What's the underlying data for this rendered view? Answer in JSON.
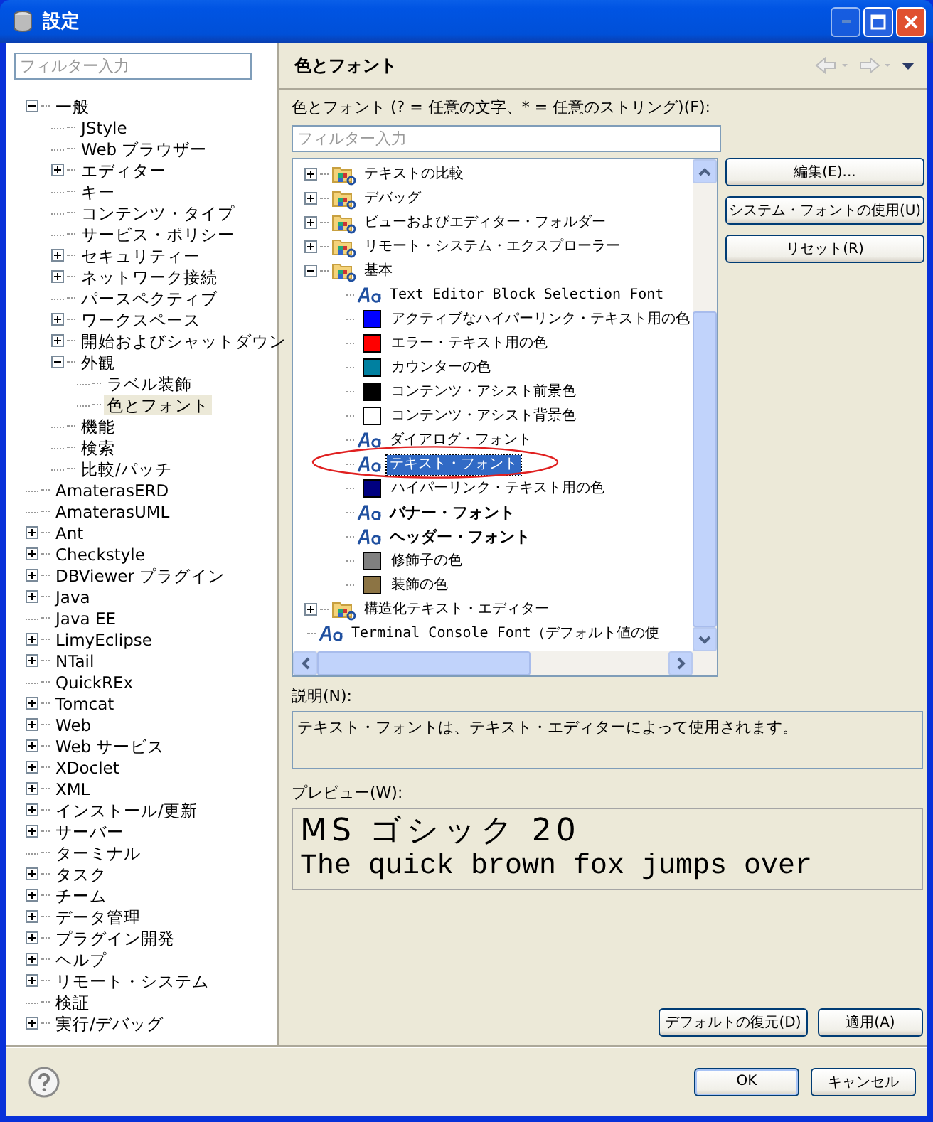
{
  "window": {
    "title": "設定"
  },
  "filter": {
    "placeholder": "フィルター入力"
  },
  "pref_tree": [
    {
      "label": "一般",
      "kind": "group",
      "expanded": true,
      "selected": false,
      "children": [
        {
          "label": "JStyle",
          "kind": "leaf",
          "selected": false
        },
        {
          "label": "Web ブラウザー",
          "kind": "leaf",
          "selected": false
        },
        {
          "label": "エディター",
          "kind": "group",
          "expanded": false,
          "selected": false
        },
        {
          "label": "キー",
          "kind": "leaf",
          "selected": false
        },
        {
          "label": "コンテンツ・タイプ",
          "kind": "leaf",
          "selected": false
        },
        {
          "label": "サービス・ポリシー",
          "kind": "leaf",
          "selected": false
        },
        {
          "label": "セキュリティー",
          "kind": "group",
          "expanded": false,
          "selected": false
        },
        {
          "label": "ネットワーク接続",
          "kind": "group",
          "expanded": false,
          "selected": false
        },
        {
          "label": "パースペクティブ",
          "kind": "leaf",
          "selected": false
        },
        {
          "label": "ワークスペース",
          "kind": "group",
          "expanded": false,
          "selected": false
        },
        {
          "label": "開始およびシャットダウン",
          "kind": "group",
          "expanded": false,
          "selected": false
        },
        {
          "label": "外観",
          "kind": "group",
          "expanded": true,
          "selected": false,
          "children": [
            {
              "label": "ラベル装飾",
              "kind": "leaf",
              "selected": false
            },
            {
              "label": "色とフォント",
              "kind": "leaf",
              "selected": true
            }
          ]
        },
        {
          "label": "機能",
          "kind": "leaf",
          "selected": false
        },
        {
          "label": "検索",
          "kind": "leaf",
          "selected": false
        },
        {
          "label": "比較/パッチ",
          "kind": "leaf",
          "selected": false
        }
      ]
    },
    {
      "label": "AmaterasERD",
      "kind": "leaf",
      "selected": false
    },
    {
      "label": "AmaterasUML",
      "kind": "leaf",
      "selected": false
    },
    {
      "label": "Ant",
      "kind": "group",
      "expanded": false,
      "selected": false
    },
    {
      "label": "Checkstyle",
      "kind": "group",
      "expanded": false,
      "selected": false
    },
    {
      "label": "DBViewer プラグイン",
      "kind": "group",
      "expanded": false,
      "selected": false
    },
    {
      "label": "Java",
      "kind": "group",
      "expanded": false,
      "selected": false
    },
    {
      "label": "Java EE",
      "kind": "leaf",
      "selected": false
    },
    {
      "label": "LimyEclipse",
      "kind": "group",
      "expanded": false,
      "selected": false
    },
    {
      "label": "NTail",
      "kind": "group",
      "expanded": false,
      "selected": false
    },
    {
      "label": "QuickREx",
      "kind": "leaf",
      "selected": false
    },
    {
      "label": "Tomcat",
      "kind": "group",
      "expanded": false,
      "selected": false
    },
    {
      "label": "Web",
      "kind": "group",
      "expanded": false,
      "selected": false
    },
    {
      "label": "Web サービス",
      "kind": "group",
      "expanded": false,
      "selected": false
    },
    {
      "label": "XDoclet",
      "kind": "group",
      "expanded": false,
      "selected": false
    },
    {
      "label": "XML",
      "kind": "group",
      "expanded": false,
      "selected": false
    },
    {
      "label": "インストール/更新",
      "kind": "group",
      "expanded": false,
      "selected": false
    },
    {
      "label": "サーバー",
      "kind": "group",
      "expanded": false,
      "selected": false
    },
    {
      "label": "ターミナル",
      "kind": "leaf",
      "selected": false
    },
    {
      "label": "タスク",
      "kind": "group",
      "expanded": false,
      "selected": false
    },
    {
      "label": "チーム",
      "kind": "group",
      "expanded": false,
      "selected": false
    },
    {
      "label": "データ管理",
      "kind": "group",
      "expanded": false,
      "selected": false
    },
    {
      "label": "プラグイン開発",
      "kind": "group",
      "expanded": false,
      "selected": false
    },
    {
      "label": "ヘルプ",
      "kind": "group",
      "expanded": false,
      "selected": false
    },
    {
      "label": "リモート・システム",
      "kind": "group",
      "expanded": false,
      "selected": false
    },
    {
      "label": "検証",
      "kind": "leaf",
      "selected": false
    },
    {
      "label": "実行/デバッグ",
      "kind": "group",
      "expanded": false,
      "selected": false
    }
  ],
  "page": {
    "title": "色とフォント",
    "tree_label": "色とフォント (? = 任意の文字、* = 任意のストリング)(F):",
    "filter": {
      "placeholder": "フィルター入力"
    },
    "tree": [
      {
        "label": "テキストの比較",
        "kind": "category",
        "expanded": false,
        "selected": false
      },
      {
        "label": "デバッグ",
        "kind": "category",
        "expanded": false,
        "selected": false
      },
      {
        "label": "ビューおよびエディター・フォルダー",
        "kind": "category",
        "expanded": false,
        "selected": false
      },
      {
        "label": "リモート・システム・エクスプローラー",
        "kind": "category",
        "expanded": false,
        "selected": false
      },
      {
        "label": "基本",
        "kind": "category",
        "expanded": true,
        "selected": false,
        "children": [
          {
            "label": "Text Editor Block Selection Font",
            "kind": "monofont",
            "selected": false
          },
          {
            "label": "アクティブなハイパーリンク・テキスト用の色",
            "kind": "color",
            "color": "#0000ff",
            "selected": false
          },
          {
            "label": "エラー・テキスト用の色",
            "kind": "color",
            "color": "#ff0000",
            "selected": false
          },
          {
            "label": "カウンターの色",
            "kind": "color",
            "color": "#0080a0",
            "selected": false
          },
          {
            "label": "コンテンツ・アシスト前景色",
            "kind": "color",
            "color": "#000000",
            "selected": false
          },
          {
            "label": "コンテンツ・アシスト背景色",
            "kind": "color",
            "color": "#ffffff",
            "selected": false
          },
          {
            "label": "ダイアログ・フォント",
            "kind": "font",
            "bold": false,
            "selected": false
          },
          {
            "label": "テキスト・フォント",
            "kind": "font",
            "bold": false,
            "selected": true
          },
          {
            "label": "ハイパーリンク・テキスト用の色",
            "kind": "color",
            "color": "#000080",
            "selected": false
          },
          {
            "label": "バナー・フォント",
            "kind": "font",
            "bold": true,
            "selected": false
          },
          {
            "label": "ヘッダー・フォント",
            "kind": "font",
            "bold": true,
            "selected": false
          },
          {
            "label": "修飾子の色",
            "kind": "color",
            "color": "#808080",
            "selected": false
          },
          {
            "label": "装飾の色",
            "kind": "color",
            "color": "#8c7444",
            "selected": false
          }
        ]
      },
      {
        "label": "構造化テキスト・エディター",
        "kind": "category",
        "expanded": false,
        "selected": false
      },
      {
        "label": "Terminal Console Font（デフォルト値の使",
        "kind": "monofont",
        "selected": false
      }
    ],
    "buttons": [
      "編集(E)...",
      "システム・フォントの使用(U)",
      "リセット(R)"
    ],
    "description_label": "説明(N):",
    "description": "テキスト・フォントは、テキスト・エディターによって使用されます。",
    "preview_label": "プレビュー(W):",
    "preview_lines": [
      "MS ゴシック 20",
      "The quick brown fox jumps over"
    ],
    "page_buttons": [
      "デフォルトの復元(D)",
      "適用(A)"
    ]
  },
  "dialog_buttons": [
    "OK",
    "キャンセル"
  ]
}
